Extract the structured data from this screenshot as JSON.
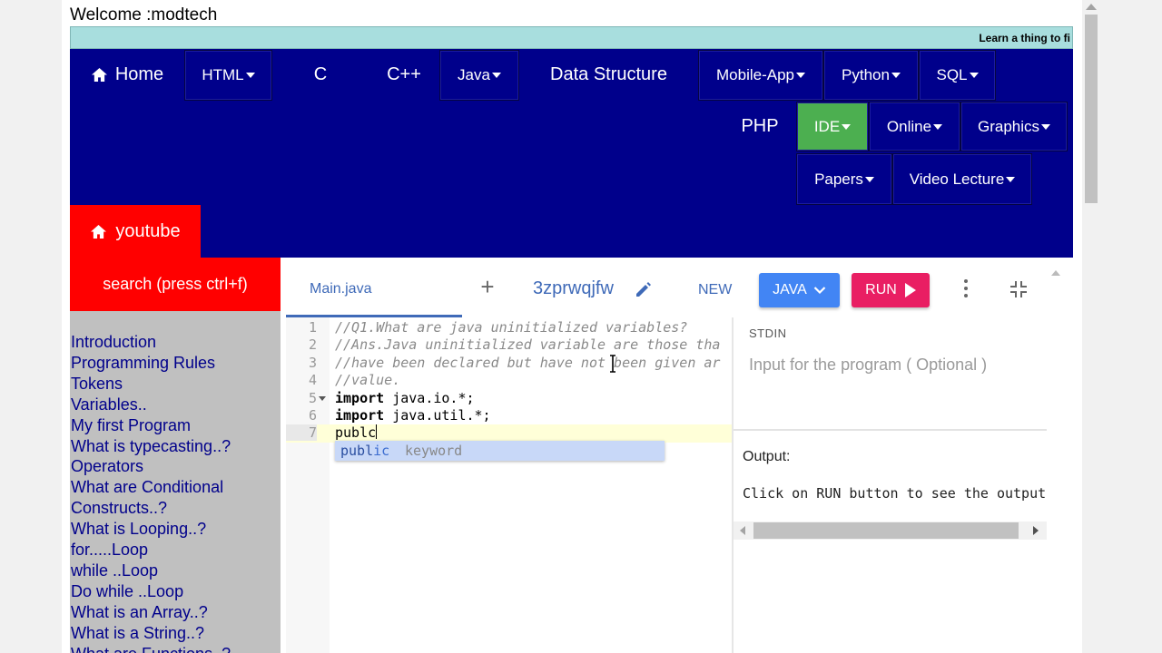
{
  "welcome": "Welcome :modtech",
  "ticker": "Learn a thing to fi",
  "nav": {
    "home": "Home",
    "html": "HTML",
    "c": "C",
    "cpp": "C++",
    "java": "Java",
    "data_structure": "Data Structure",
    "mobile_app": "Mobile-App",
    "python": "Python",
    "sql": "SQL",
    "php": "PHP",
    "ide": "IDE",
    "online": "Online",
    "graphics": "Graphics",
    "papers": "Papers",
    "video_lecture": "Video Lecture",
    "youtube": "youtube",
    "active_color": "#4caf50",
    "bg_color": "#00008b"
  },
  "sidebar": {
    "search": "search (press ctrl+f)",
    "links": [
      "Introduction",
      "Programming Rules",
      "Tokens",
      "Variables..",
      "My first Program",
      "What is typecasting..?",
      "Operators",
      "What are Conditional",
      "Constructs..?",
      "What is Looping..?",
      "for.....Loop",
      "while ..Loop",
      "Do while ..Loop",
      "What is an Array..?",
      "What is a String..?",
      "What are Functions..?"
    ]
  },
  "ide": {
    "tab": "Main.java",
    "plus": "+",
    "file_id": "3zprwqjfw",
    "new_label": "NEW",
    "lang_label": "JAVA",
    "run_label": "RUN",
    "lines": [
      {
        "n": "1",
        "comment": "//Q1.What are java uninitialized variables?"
      },
      {
        "n": "2",
        "comment": "//Ans.Java uninitialized variable are those tha"
      },
      {
        "n": "3",
        "comment": "//have been declared but have not been given ar"
      },
      {
        "n": "4",
        "comment": "//value."
      },
      {
        "n": "5",
        "kw": "import",
        "rest": " java.io.*;"
      },
      {
        "n": "6",
        "kw": "import",
        "rest": " java.util.*;"
      },
      {
        "n": "7",
        "rest": "publc"
      }
    ],
    "autocomplete": {
      "match": "publ",
      "rest": "ic",
      "type": "keyword"
    },
    "stdin_label": "STDIN",
    "stdin_placeholder": "Input for the program ( Optional )",
    "output_label": "Output:",
    "output_text": "Click on RUN button to see the output"
  }
}
